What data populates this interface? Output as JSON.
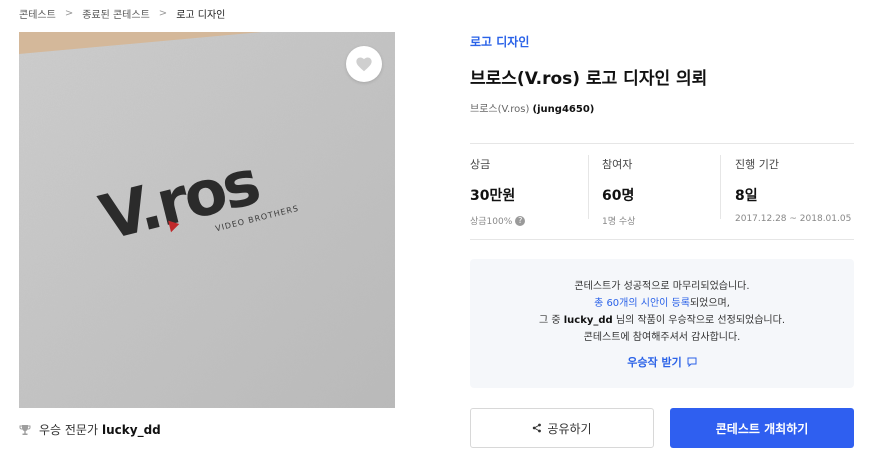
{
  "breadcrumb": {
    "items": [
      "콘테스트",
      "종료된 콘테스트",
      "로고 디자인"
    ],
    "separator": ">"
  },
  "hero": {
    "logo_text": "V.ros",
    "logo_tagline": "VIDEO BROTHERS",
    "like_icon": "heart-icon"
  },
  "winner": {
    "label": "우승 전문가",
    "name": "lucky_dd"
  },
  "contest": {
    "category": "로고 디자인",
    "title": "브로스(V.ros) 로고 디자인 의뢰",
    "host_name": "브로스(V.ros)",
    "host_id": "(jung4650)"
  },
  "stats": {
    "prize": {
      "label": "상금",
      "value": "30만원",
      "sub": "상금100%"
    },
    "participants": {
      "label": "참여자",
      "value": "60명",
      "sub": "1명 수상"
    },
    "period": {
      "label": "진행 기간",
      "value": "8일",
      "sub": "2017.12.28 ~ 2018.01.05"
    }
  },
  "notice": {
    "line1": "콘테스트가 성공적으로 마무리되었습니다.",
    "line2_link": "총 60개의 시안이 등록",
    "line2_rest": "되었으며,",
    "line3_pre": "그 중 ",
    "line3_name": "lucky_dd",
    "line3_post": " 님의 작품이 우승작으로 선정되었습니다.",
    "line4": "콘테스트에 참여해주셔서 감사합니다.",
    "prize_link": "우승작 받기"
  },
  "actions": {
    "share_label": "공유하기",
    "host_label": "콘테스트 개최하기"
  },
  "colors": {
    "accent": "#2f5ff0",
    "link": "#2a62e8",
    "notice_bg": "#f5f7fa"
  }
}
